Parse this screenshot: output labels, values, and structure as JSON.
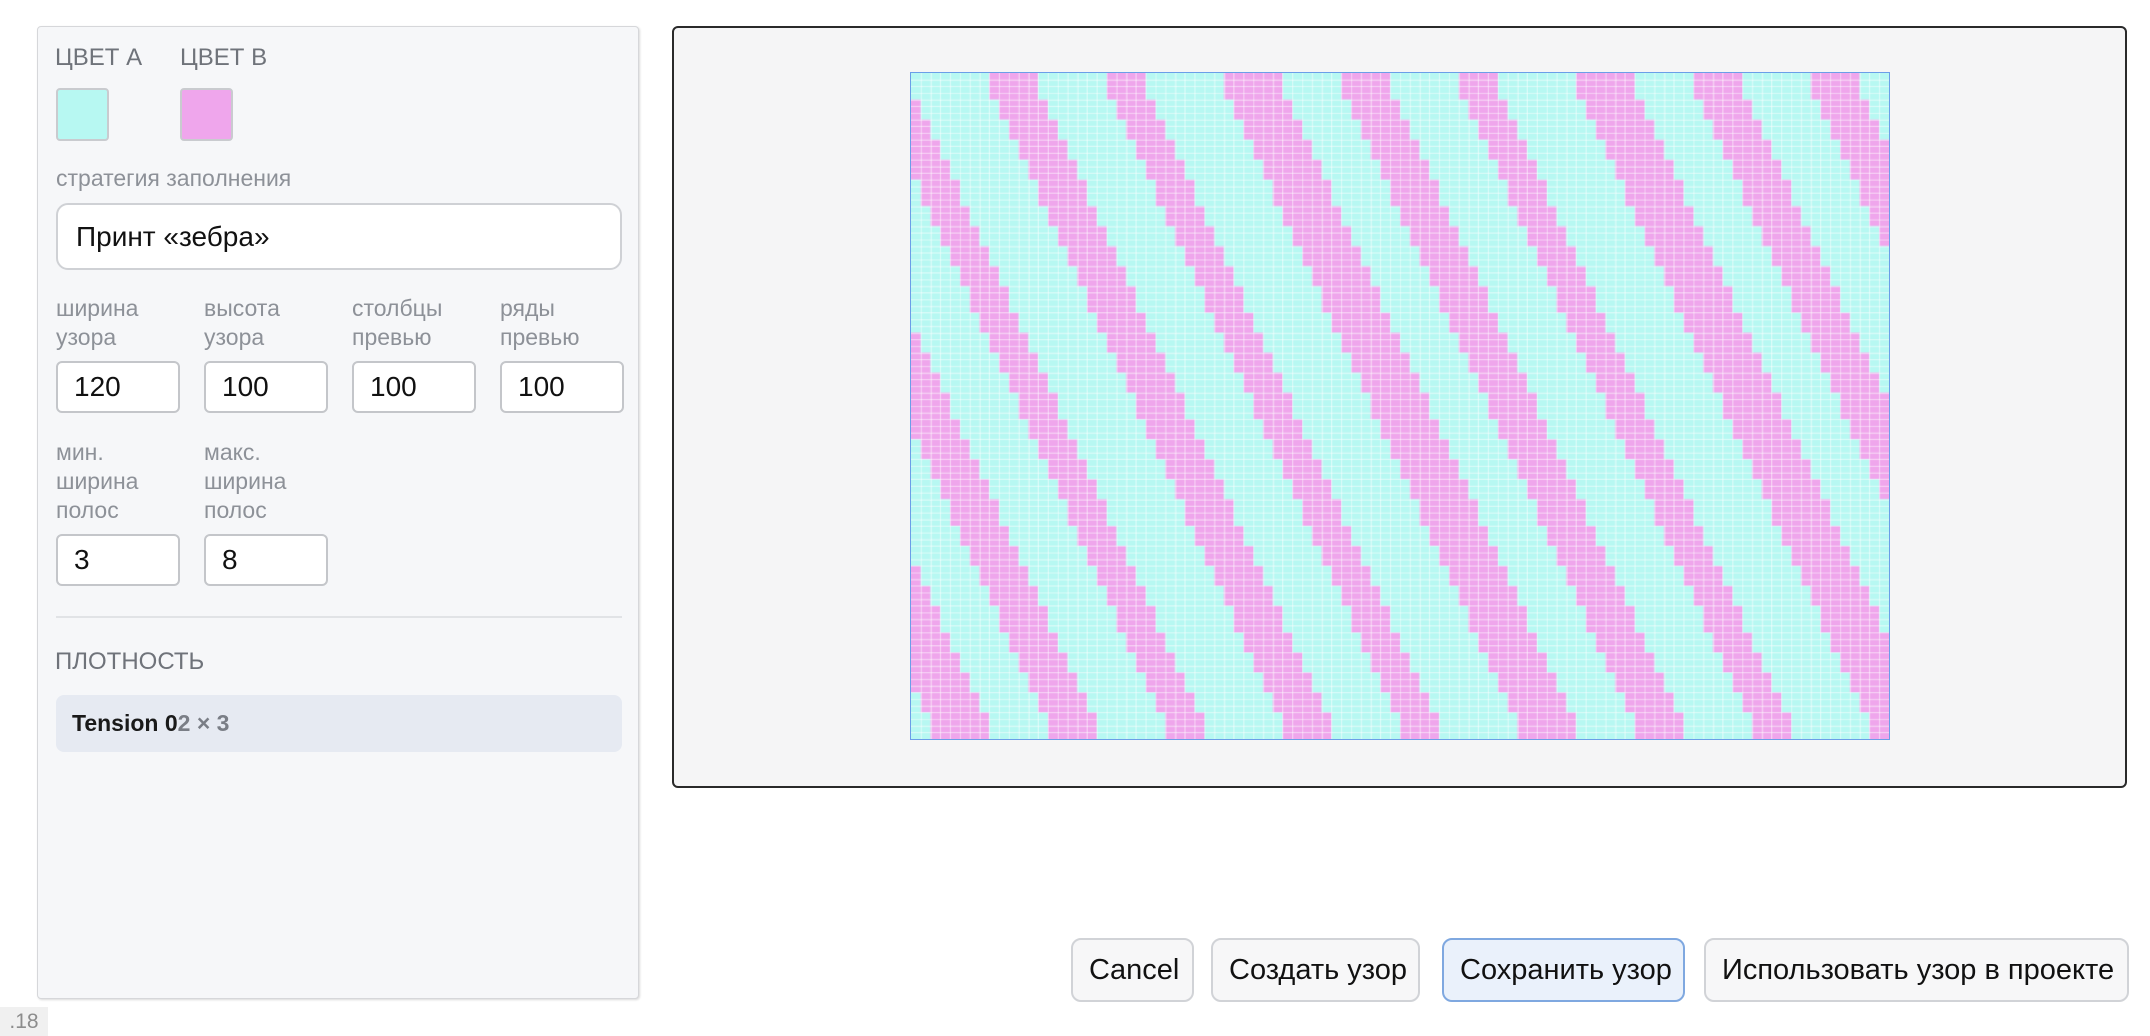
{
  "colors": {
    "color_a": "#b7f8f2",
    "color_b": "#efa6ec",
    "accent": "#7fa8e0"
  },
  "sidebar": {
    "color_a_label": "ЦВЕТ A",
    "color_b_label": "ЦВЕТ B",
    "strategy_label": "стратегия заполнения",
    "strategy_value": "Принт «зебра»",
    "fields": {
      "pattern_width": {
        "label": "ширина узора",
        "value": "120"
      },
      "pattern_height": {
        "label": "высота узора",
        "value": "100"
      },
      "preview_cols": {
        "label": "столбцы превью",
        "value": "100"
      },
      "preview_rows": {
        "label": "ряды превью",
        "value": "100"
      },
      "min_stripe": {
        "label": "мин. ширина полос",
        "value": "3"
      },
      "max_stripe": {
        "label": "макс. ширина полос",
        "value": "8"
      }
    },
    "density_label": "ПЛОТНОСТЬ",
    "density_item": {
      "name": "Tension 0",
      "dims": "2 × 3"
    }
  },
  "preview": {
    "cols": 100,
    "rows": 100
  },
  "buttons": {
    "cancel": "Cancel",
    "create": "Создать узор",
    "save": "Сохранить узор",
    "use": "Использовать узор в проекте"
  },
  "version": ".18"
}
